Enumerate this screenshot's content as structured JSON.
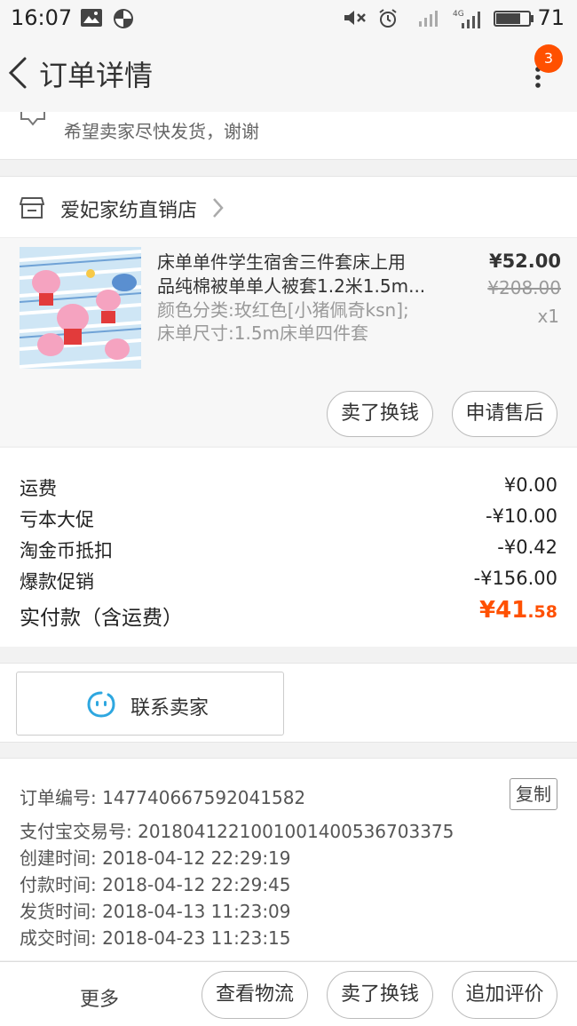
{
  "status_bar": {
    "time": "16:07",
    "battery": "71"
  },
  "nav": {
    "title": "订单详情",
    "badge_count": "3"
  },
  "message": {
    "text": "希望卖家尽快发货，谢谢"
  },
  "shop": {
    "name": "爱妃家纺直销店"
  },
  "product": {
    "title_line1": "床单单件学生宿舍三件套床上用",
    "title_line2": "品纯棉被单单人被套1.2米1.5m...",
    "sku_line1": "颜色分类:玫红色[小猪佩奇ksn];",
    "sku_line2": "床单尺寸:1.5m床单四件套",
    "price": "¥52.00",
    "original_price": "¥208.00",
    "quantity": "x1",
    "btn_sell": "卖了换钱",
    "btn_aftersale": "申请售后"
  },
  "fees": {
    "rows": [
      {
        "label": "运费",
        "value": "¥0.00"
      },
      {
        "label": "亏本大促",
        "value": "-¥10.00"
      },
      {
        "label": "淘金币抵扣",
        "value": "-¥0.42"
      },
      {
        "label": "爆款促销",
        "value": "-¥156.00"
      }
    ],
    "total_label": "实付款（含运费）",
    "total_currency": "¥",
    "total_int": "41",
    "total_dec": ".58"
  },
  "contact": {
    "label": "联系卖家"
  },
  "order_info": {
    "order_no": "订单编号: 147740667592041582",
    "alipay_no": "支付宝交易号: 2018041221001001400536703375",
    "created": "创建时间: 2018-04-12 22:29:19",
    "paid": "付款时间: 2018-04-12 22:29:45",
    "shipped": "发货时间: 2018-04-13 11:23:09",
    "completed": "成交时间: 2018-04-23 11:23:15",
    "copy_label": "复制"
  },
  "bottom_bar": {
    "more": "更多",
    "logistics": "查看物流",
    "sell": "卖了换钱",
    "review": "追加评价"
  },
  "colors": {
    "accent": "#ff5000",
    "badge": "#ff5000",
    "contact_icon": "#2ea7e0"
  }
}
